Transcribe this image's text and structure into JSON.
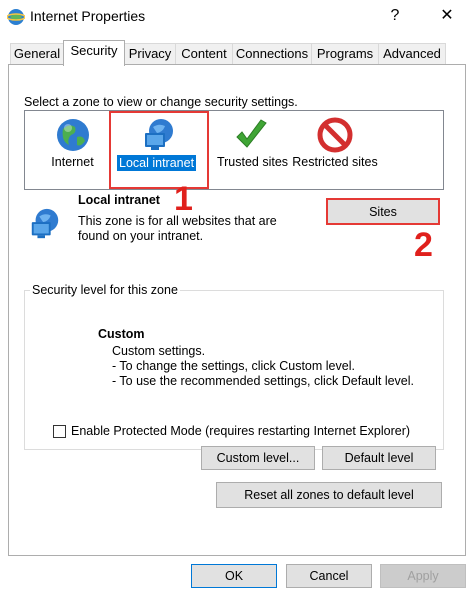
{
  "window": {
    "title": "Internet Properties",
    "help_glyph": "?",
    "close_glyph": "✕"
  },
  "tabs": [
    {
      "label": "General"
    },
    {
      "label": "Security"
    },
    {
      "label": "Privacy"
    },
    {
      "label": "Content"
    },
    {
      "label": "Connections"
    },
    {
      "label": "Programs"
    },
    {
      "label": "Advanced"
    }
  ],
  "security": {
    "zone_prompt": "Select a zone to view or change security settings.",
    "zones": [
      {
        "label": "Internet",
        "icon": "globe-icon"
      },
      {
        "label": "Local intranet",
        "icon": "intranet-icon",
        "selected": true
      },
      {
        "label": "Trusted sites",
        "icon": "checkmark-icon"
      },
      {
        "label": "Restricted sites",
        "icon": "restricted-icon"
      }
    ],
    "selected_zone": {
      "title": "Local intranet",
      "description_line1": "This zone is for all websites that are",
      "description_line2": "found on your intranet."
    },
    "sites_button": "Sites",
    "annotations": {
      "mark1": "1",
      "mark2": "2"
    },
    "level_group_label": "Security level for this zone",
    "level_title": "Custom",
    "level_line1": "Custom settings.",
    "level_line2": "- To change the settings, click Custom level.",
    "level_line3": "- To use the recommended settings, click Default level.",
    "protected_mode_label": "Enable Protected Mode (requires restarting Internet Explorer)",
    "protected_mode_checked": false,
    "custom_level_button": "Custom level...",
    "default_level_button": "Default level",
    "reset_all_button": "Reset all zones to default level"
  },
  "footer": {
    "ok": "OK",
    "cancel": "Cancel",
    "apply": "Apply"
  },
  "colors": {
    "selection": "#0078d7",
    "annotation_red": "#e53935"
  }
}
